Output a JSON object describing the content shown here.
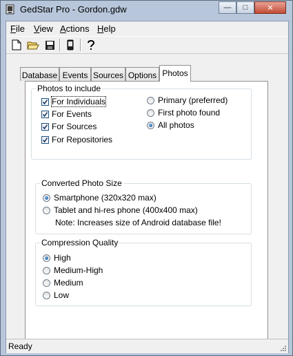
{
  "window": {
    "title": "GedStar Pro - Gordon.gdw"
  },
  "title_buttons": {
    "minimize": "—",
    "maximize": "□",
    "close": "✕"
  },
  "menu": [
    "File",
    "View",
    "Actions",
    "Help"
  ],
  "menu_accel": [
    "F",
    "V",
    "A",
    "H"
  ],
  "toolbar": {
    "icons": [
      "new-file-icon",
      "open-folder-icon",
      "save-disk-icon",
      "phone-device-icon",
      "help-icon"
    ]
  },
  "tabs": [
    "Database",
    "Events",
    "Sources",
    "Options",
    "Photos"
  ],
  "active_tab": "Photos",
  "photos_to_include": {
    "title": "Photos to include",
    "checkboxes": [
      {
        "label": "For Individuals",
        "checked": true
      },
      {
        "label": "For Events",
        "checked": true
      },
      {
        "label": "For Sources",
        "checked": true
      },
      {
        "label": "For Repositories",
        "checked": true
      }
    ],
    "radios": [
      {
        "label": "Primary (preferred)",
        "selected": false
      },
      {
        "label": "First photo found",
        "selected": false
      },
      {
        "label": "All photos",
        "selected": true
      }
    ]
  },
  "converted_photo_size": {
    "title": "Converted Photo Size",
    "radios": [
      {
        "label": "Smartphone (320x320 max)",
        "selected": true
      },
      {
        "label": "Tablet and hi-res phone (400x400 max)",
        "selected": false
      }
    ],
    "note": "Note: Increases size of Android database file!"
  },
  "compression_quality": {
    "title": "Compression Quality",
    "radios": [
      {
        "label": "High",
        "selected": true
      },
      {
        "label": "Medium-High",
        "selected": false
      },
      {
        "label": "Medium",
        "selected": false
      },
      {
        "label": "Low",
        "selected": false
      }
    ]
  },
  "status": {
    "text": "Ready"
  },
  "colors": {
    "frame": "#b7c6da",
    "client": "#f0f0f0",
    "panel": "#ffffff",
    "radio_dot": "#1a4f8a"
  }
}
